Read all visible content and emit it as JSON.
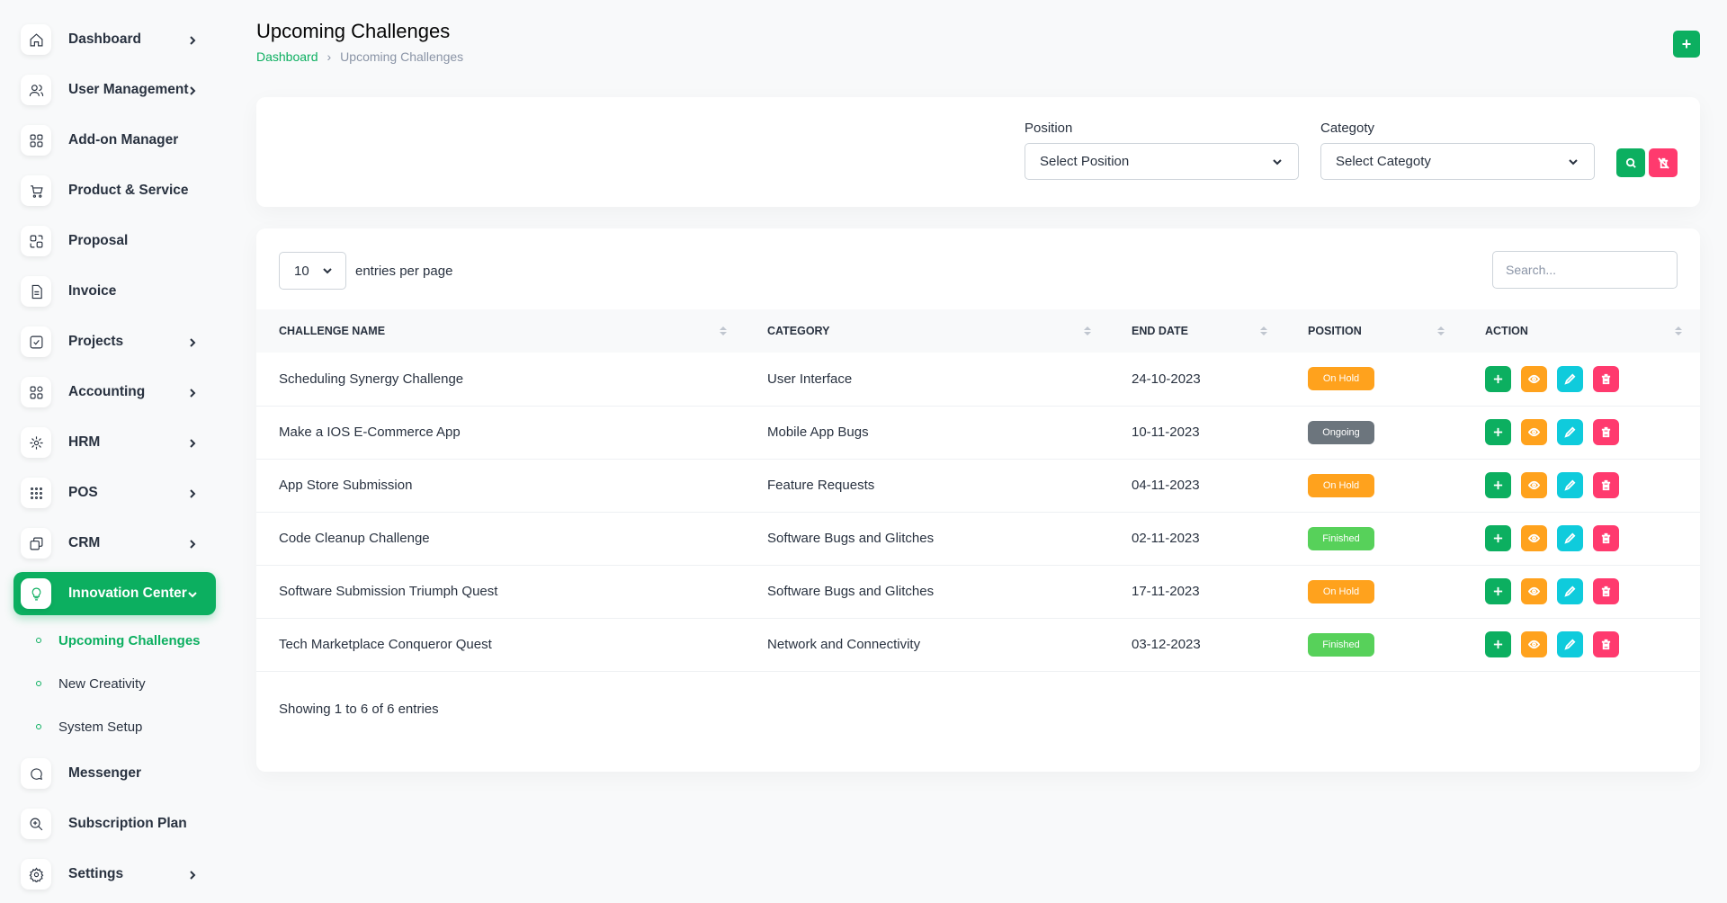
{
  "sidebar": {
    "items": [
      {
        "label": "Dashboard",
        "icon": "home-icon"
      },
      {
        "label": "User Management",
        "icon": "users-icon"
      },
      {
        "label": "Add-on Manager",
        "icon": "grid-icon"
      },
      {
        "label": "Product & Service",
        "icon": "cart-icon"
      },
      {
        "label": "Proposal",
        "icon": "proposal-icon"
      },
      {
        "label": "Invoice",
        "icon": "invoice-icon"
      },
      {
        "label": "Projects",
        "icon": "check-square-icon"
      },
      {
        "label": "Accounting",
        "icon": "apps-icon"
      },
      {
        "label": "HRM",
        "icon": "hrm-icon"
      },
      {
        "label": "POS",
        "icon": "pos-icon"
      },
      {
        "label": "CRM",
        "icon": "crm-icon"
      },
      {
        "label": "Innovation Center",
        "icon": "bulb-icon"
      },
      {
        "label": "Messenger",
        "icon": "message-icon"
      },
      {
        "label": "Subscription Plan",
        "icon": "search-plan-icon"
      },
      {
        "label": "Settings",
        "icon": "gear-icon"
      }
    ],
    "sub_items": [
      {
        "label": "Upcoming Challenges"
      },
      {
        "label": "New Creativity"
      },
      {
        "label": "System Setup"
      }
    ]
  },
  "header": {
    "title": "Upcoming Challenges",
    "breadcrumb": {
      "home": "Dashboard",
      "current": "Upcoming Challenges"
    },
    "add_label": "+"
  },
  "filters": {
    "position_label": "Position",
    "position_value": "Select Position",
    "category_label": "Categoty",
    "category_value": "Select Categoty"
  },
  "table": {
    "per_page": "10",
    "per_page_text": "entries per page",
    "search_placeholder": "Search...",
    "columns": [
      "CHALLENGE NAME",
      "CATEGORY",
      "END DATE",
      "POSITION",
      "ACTION"
    ],
    "rows": [
      {
        "name": "Scheduling Synergy Challenge",
        "category": "User Interface",
        "end_date": "24-10-2023",
        "position": "On Hold"
      },
      {
        "name": "Make a IOS E-Commerce App",
        "category": "Mobile App Bugs",
        "end_date": "10-11-2023",
        "position": "Ongoing"
      },
      {
        "name": "App Store Submission",
        "category": "Feature Requests",
        "end_date": "04-11-2023",
        "position": "On Hold"
      },
      {
        "name": "Code Cleanup Challenge",
        "category": "Software Bugs and Glitches",
        "end_date": "02-11-2023",
        "position": "Finished"
      },
      {
        "name": "Software Submission Triumph Quest",
        "category": "Software Bugs and Glitches",
        "end_date": "17-11-2023",
        "position": "On Hold"
      },
      {
        "name": "Tech Marketplace Conqueror Quest",
        "category": "Network and Connectivity",
        "end_date": "03-12-2023",
        "position": "Finished"
      }
    ],
    "footer": "Showing 1 to 6 of 6 entries"
  },
  "colors": {
    "primary": "#0caf60",
    "on_hold": "#ffa21d",
    "ongoing": "#6c757d",
    "finished": "#57d15a",
    "view": "#ffa21d",
    "edit": "#0fcbdc",
    "delete": "#ff3a6e"
  }
}
